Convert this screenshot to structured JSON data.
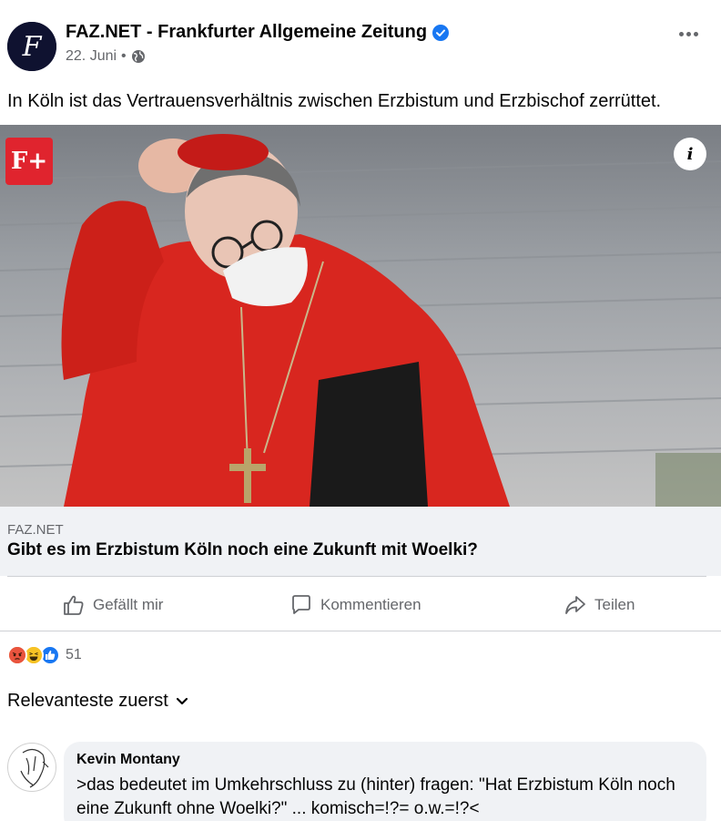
{
  "post": {
    "page_name": "FAZ.NET - Frankfurter Allgemeine Zeitung",
    "date": "22. Juni",
    "separator": "•",
    "text": "In Köln ist das Vertrauensverhältnis zwischen Erzbistum und Erzbischof zerrüttet.",
    "avatar_letter": "F"
  },
  "link_preview": {
    "badge": "F+",
    "info_icon_label": "i",
    "domain": "FAZ.NET",
    "title": "Gibt es im Erzbistum Köln noch eine Zukunft mit Woelki?"
  },
  "actions": {
    "like_label": "Gefällt mir",
    "comment_label": "Kommentieren",
    "share_label": "Teilen"
  },
  "reactions": {
    "count": "51",
    "types": [
      "angry-icon",
      "haha-icon",
      "like-icon"
    ]
  },
  "comments_sort": {
    "label": "Relevanteste zuerst"
  },
  "comment": {
    "author": "Kevin Montany",
    "text": ">das bedeutet im Umkehrschluss zu (hinter) fragen: \"Hat Erzbistum Köln noch eine Zukunft ohne Woelki?\" ... komisch=!?= o.w.=!?<"
  },
  "colors": {
    "brand_blue": "#1877f2",
    "text_secondary": "#65676b",
    "cardinal_red": "#d8261f",
    "faz_red": "#e0242e"
  }
}
